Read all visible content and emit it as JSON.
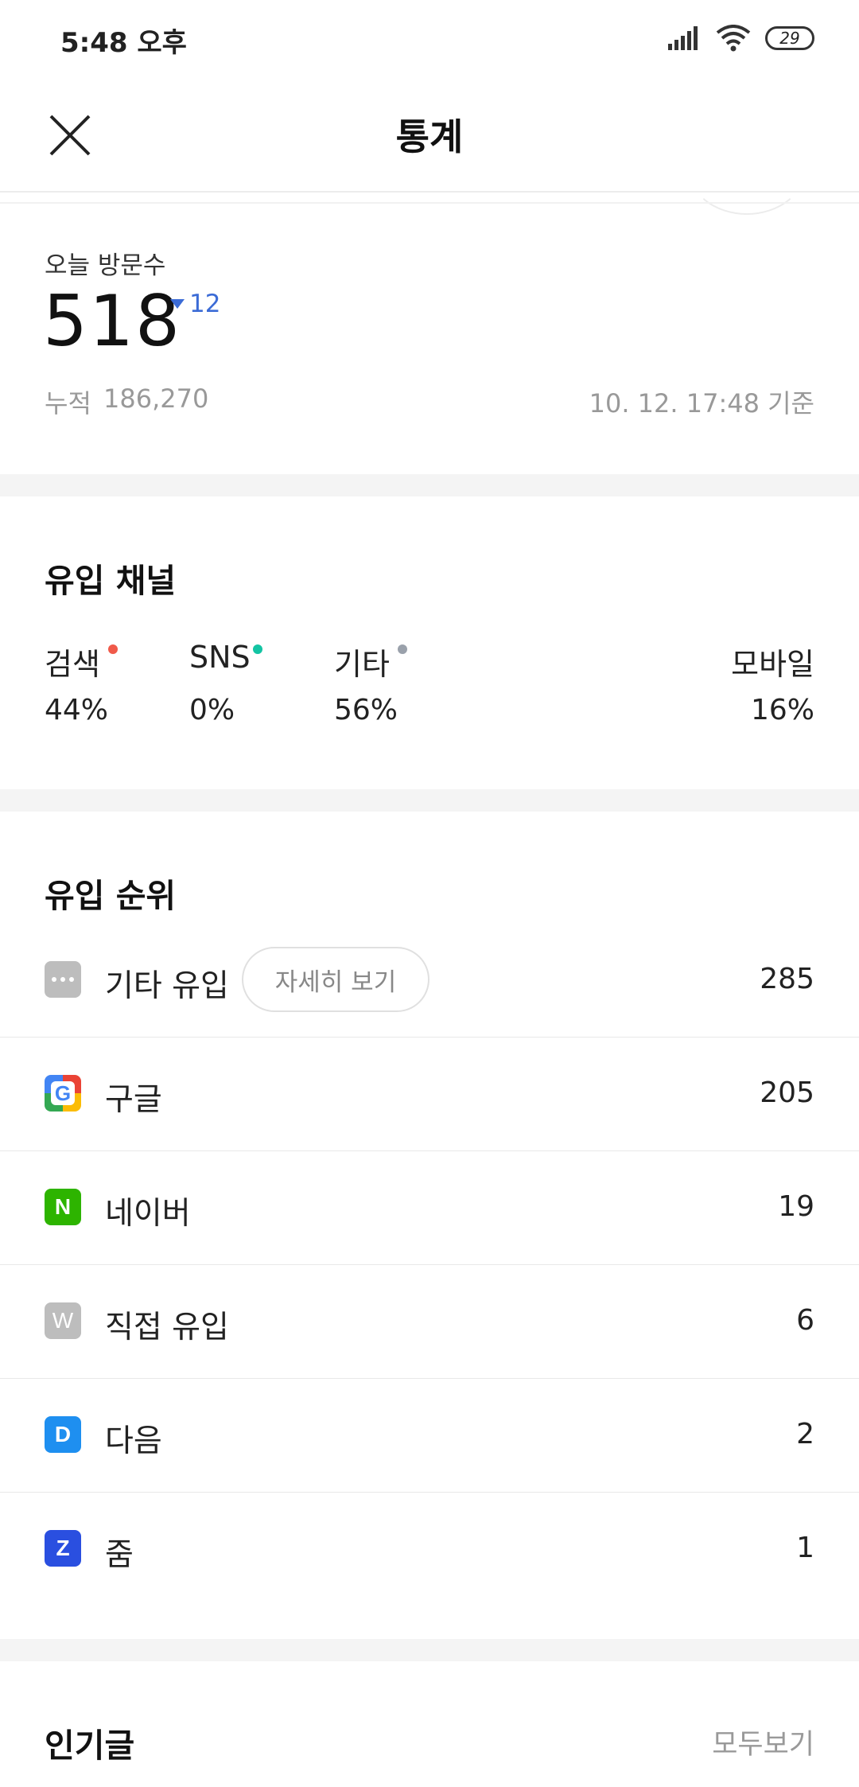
{
  "status_bar": {
    "time": "5:48 오후",
    "battery": "29"
  },
  "header": {
    "title": "통계"
  },
  "visits": {
    "label": "오늘 방문수",
    "value": "518",
    "delta": "12",
    "cumulative_label": "누적",
    "cumulative_value": "186,270",
    "as_of": "10. 12. 17:48 기준"
  },
  "channels": {
    "title": "유입 채널",
    "items": [
      {
        "label": "검색",
        "value": "44%",
        "dot_color": "#f05a4a"
      },
      {
        "label": "SNS",
        "value": "0%",
        "dot_color": "#13c4a3"
      },
      {
        "label": "기타",
        "value": "56%",
        "dot_color": "#9aa1ab"
      },
      {
        "label": "모바일",
        "value": "16%"
      }
    ]
  },
  "ranking": {
    "title": "유입 순위",
    "detail_button": "자세히 보기",
    "items": [
      {
        "label": "기타 유입",
        "value": "285",
        "icon": "more-dots-icon"
      },
      {
        "label": "구글",
        "value": "205",
        "icon": "google-icon"
      },
      {
        "label": "네이버",
        "value": "19",
        "icon": "naver-icon"
      },
      {
        "label": "직접 유입",
        "value": "6",
        "icon": "direct-w-icon"
      },
      {
        "label": "다음",
        "value": "2",
        "icon": "daum-icon"
      },
      {
        "label": "줌",
        "value": "1",
        "icon": "zum-icon"
      }
    ]
  },
  "popular": {
    "title": "인기글",
    "view_all": "모두보기"
  },
  "colors": {
    "naver": "#2db400",
    "daum": "#1e8ff0",
    "zum": "#2a4fe0",
    "google_blue": "#4285f4",
    "accent_blue": "#3b6bd6",
    "icon_gray": "#bdbdbd"
  }
}
